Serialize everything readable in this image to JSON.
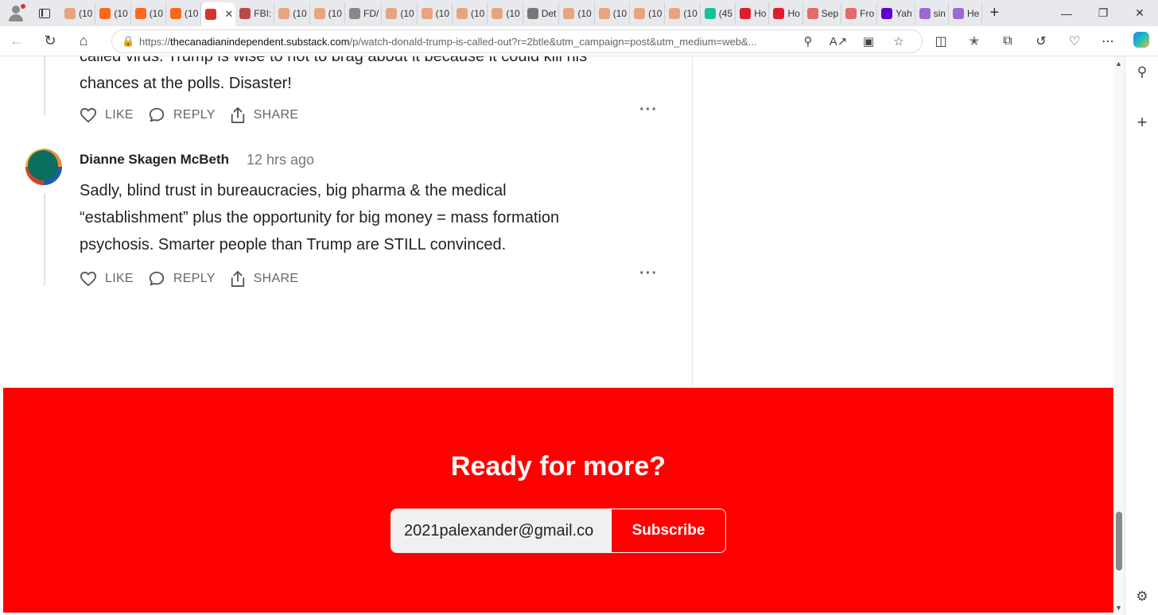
{
  "browser": {
    "tabs": [
      {
        "label": "(10",
        "color": "#e8a47f"
      },
      {
        "label": "(10",
        "color": "#ff6719"
      },
      {
        "label": "(10",
        "color": "#ff6719"
      },
      {
        "label": "(10",
        "color": "#ff6719"
      },
      {
        "label": "",
        "color": "#d9342b",
        "active": true
      },
      {
        "label": "FBI:",
        "color": "#b84a4a"
      },
      {
        "label": "(10",
        "color": "#e8a47f"
      },
      {
        "label": "(10",
        "color": "#e8a47f"
      },
      {
        "label": "FD/",
        "color": "#888888"
      },
      {
        "label": "(10",
        "color": "#e8a47f"
      },
      {
        "label": "(10",
        "color": "#e8a47f"
      },
      {
        "label": "(10",
        "color": "#e8a47f"
      },
      {
        "label": "(10",
        "color": "#e8a47f"
      },
      {
        "label": "Det",
        "color": "#777777"
      },
      {
        "label": "(10",
        "color": "#e8a47f"
      },
      {
        "label": "(10",
        "color": "#e8a47f"
      },
      {
        "label": "(10",
        "color": "#e8a47f"
      },
      {
        "label": "(10",
        "color": "#e8a47f"
      },
      {
        "label": "(45",
        "color": "#15c39a"
      },
      {
        "label": "Ho",
        "color": "#e11d2b"
      },
      {
        "label": "Ho",
        "color": "#e11d2b"
      },
      {
        "label": "Sep",
        "color": "#e26a6a"
      },
      {
        "label": "Fro",
        "color": "#e26a6a"
      },
      {
        "label": "Yah",
        "color": "#6001d2"
      },
      {
        "label": "sin",
        "color": "#9b6ad6"
      },
      {
        "label": "He",
        "color": "#9b6ad6"
      }
    ],
    "url_prefix": "https://",
    "url_host": "thecanadianindependent.substack.com",
    "url_path": "/p/watch-donald-trump-is-called-out?r=2btle&utm_campaign=post&utm_medium=web&..."
  },
  "comments": [
    {
      "text_partial": "called virus. Trump is wise to not to brag about it because it could kill his",
      "text": "chances at the polls. Disaster!",
      "like": "LIKE",
      "reply": "REPLY",
      "share": "SHARE"
    },
    {
      "author": "Dianne Skagen McBeth",
      "time": "12 hrs ago",
      "line1": "Sadly, blind trust in bureaucracies, big pharma & the medical",
      "line2": "“establishment” plus the opportunity for big money = mass formation",
      "line3": "psychosis. Smarter people than Trump are STILL convinced.",
      "like": "LIKE",
      "reply": "REPLY",
      "share": "SHARE"
    }
  ],
  "cta": {
    "title": "Ready for more?",
    "email_value": "2021palexander@gmail.co",
    "subscribe_label": "Subscribe",
    "color": "#ff0000"
  }
}
